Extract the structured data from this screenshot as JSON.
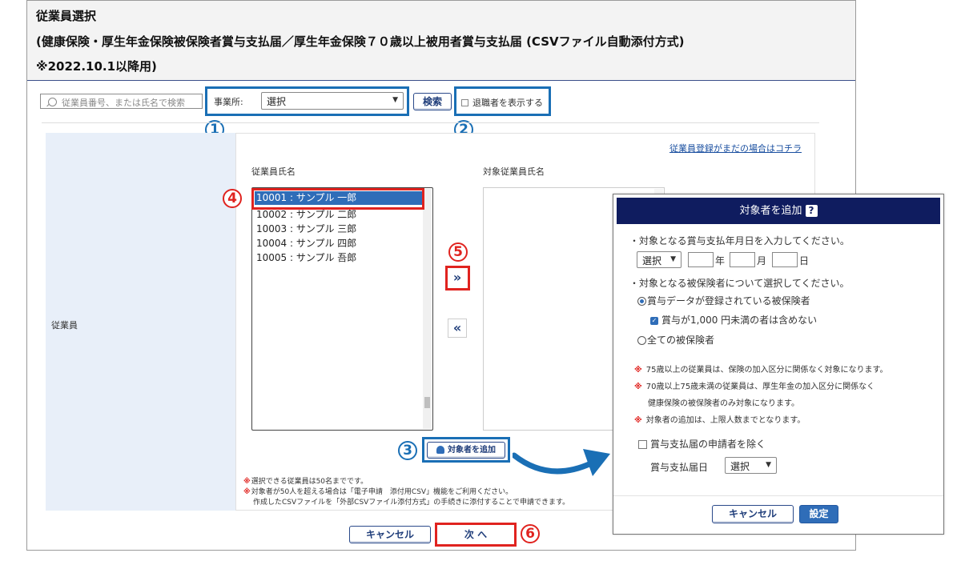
{
  "header": {
    "title": "従業員選択",
    "subtitle": "(健康保険・厚生年金保険被保険者賞与支払届／厚生年金保険７０歳以上被用者賞与支払届 (CSVファイル自動添付方式)",
    "note": "※2022.10.1以降用)"
  },
  "toolbar": {
    "search_placeholder": "従業員番号、または氏名で検索",
    "office_label": "事業所:",
    "office_select": "選択",
    "search_button": "検索",
    "retired_label": "退職者を表示する"
  },
  "callouts": [
    "1",
    "2",
    "3",
    "4",
    "5",
    "6"
  ],
  "main": {
    "row_label": "従業員",
    "register_link": "従業員登録がまだの場合はコチラ",
    "employee_list_label": "従業員氏名",
    "target_list_label": "対象従業員氏名",
    "employees": [
      "10001 : サンプル 一郎",
      "10002 : サンプル 二郎",
      "10003 : サンプル 三郎",
      "10004 : サンプル 四郎",
      "10005 : サンプル 吾郎"
    ],
    "add_right_symbol": "»",
    "add_left_symbol": "«",
    "add_target_button": "対象者を追加",
    "notes": [
      "選択できる従業員は50名までです。",
      "対象者が50人を超える場合は「電子申請　添付用CSV」機能をご利用ください。",
      "作成したCSVファイルを「外部CSVファイル添付方式」の手続きに添付することで申請できます。"
    ]
  },
  "footer": {
    "cancel_button": "キャンセル",
    "next_button": "次 へ"
  },
  "modal": {
    "title": "対象者を追加",
    "help": "?",
    "line1": "・対象となる賞与支払年月日を入力してください。",
    "era_select": "選択",
    "year_label": "年",
    "month_label": "月",
    "day_label": "日",
    "line2": "・対象となる被保険者について選択してください。",
    "radio1": "賞与データが登録されている被保険者",
    "check1": "賞与が1,000 円未満の者は含めない",
    "radio2": "全ての被保険者",
    "notes": [
      "75歳以上の従業員は、保険の加入区分に関係なく対象になります。",
      "70歳以上75歳未満の従業員は、厚生年金の加入区分に関係なく",
      "健康保険の被保険者のみ対象になります。",
      "対象者の追加は、上限人数までとなります。"
    ],
    "exclude_label": "賞与支払届の申請者を除く",
    "pay_date_label": "賞与支払届日",
    "pay_date_select": "選択",
    "cancel_button": "キャンセル",
    "ok_button": "設定"
  },
  "colors": {
    "callout_blue": "#1a6fb5",
    "callout_red": "#e0231f",
    "modal_header": "#0f1c5f",
    "accent": "#2f6db8"
  }
}
